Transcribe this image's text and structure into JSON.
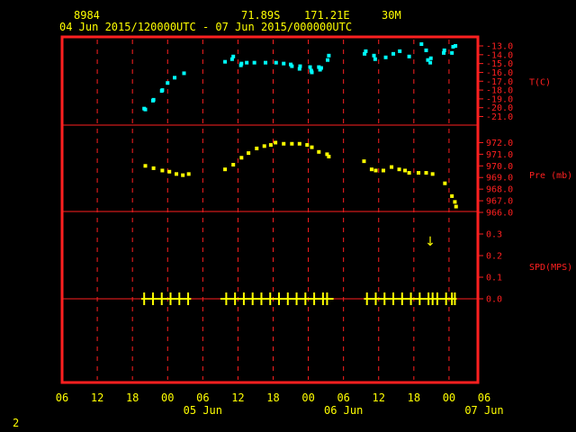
{
  "header": {
    "station_id": "8984",
    "lat": "71.89S",
    "lon": "171.21E",
    "interval": "30M",
    "period": "04 Jun 2015/120000UTC - 07 Jun 2015/000000UTC"
  },
  "footer": {
    "page_number": "2"
  },
  "colors": {
    "frame": "#ff2020",
    "temp": "#00ffff",
    "pressure": "#ffff00",
    "wind": "#ffff00",
    "text": "#ffff00"
  },
  "chart_data": [
    {
      "type": "scatter",
      "panel": "temperature",
      "ylabel": "T(C)",
      "ylim": [
        -21,
        -13
      ],
      "yticks": [
        "-13.0",
        "-14.0",
        "-15.0",
        "-16.0",
        "-17.0",
        "-18.0",
        "-19.0",
        "-20.0",
        "-21.0"
      ],
      "x_unit": "hours since 04 Jun 2015 06 UTC",
      "points": [
        [
          14,
          -20.1
        ],
        [
          14.2,
          -20.2
        ],
        [
          15.5,
          -19.2
        ],
        [
          15.6,
          -19.1
        ],
        [
          17,
          -18.1
        ],
        [
          17.1,
          -18.0
        ],
        [
          18,
          -17.2
        ],
        [
          19.2,
          -16.6
        ],
        [
          20.8,
          -16.1
        ],
        [
          27.8,
          -14.8
        ],
        [
          29,
          -14.5
        ],
        [
          29.2,
          -14.2
        ],
        [
          30.5,
          -15.2
        ],
        [
          30.6,
          -15.0
        ],
        [
          31.5,
          -14.9
        ],
        [
          32.8,
          -14.9
        ],
        [
          34.7,
          -14.9
        ],
        [
          36.5,
          -14.9
        ],
        [
          37.8,
          -15.0
        ],
        [
          39,
          -15.1
        ],
        [
          39.2,
          -15.3
        ],
        [
          40.5,
          -15.6
        ],
        [
          40.6,
          -15.3
        ],
        [
          42.3,
          -15.4
        ],
        [
          42.5,
          -15.8
        ],
        [
          42.6,
          -16.0
        ],
        [
          43.8,
          -15.4
        ],
        [
          44,
          -15.7
        ],
        [
          44.2,
          -15.5
        ],
        [
          45.3,
          -14.6
        ],
        [
          45.5,
          -14.1
        ],
        [
          51.6,
          -13.9
        ],
        [
          51.8,
          -13.6
        ],
        [
          53.2,
          -14.1
        ],
        [
          53.4,
          -14.5
        ],
        [
          55.2,
          -14.3
        ],
        [
          56.5,
          -13.9
        ],
        [
          57.6,
          -13.6
        ],
        [
          59.2,
          -14.2
        ],
        [
          61.3,
          -12.8
        ],
        [
          62.1,
          -13.5
        ],
        [
          62.4,
          -14.6
        ],
        [
          62.8,
          -14.9
        ],
        [
          62.9,
          -14.4
        ],
        [
          65.1,
          -13.8
        ],
        [
          65.2,
          -13.5
        ],
        [
          66.5,
          -13.8
        ],
        [
          66.7,
          -13.1
        ],
        [
          67.1,
          -13.0
        ]
      ]
    },
    {
      "type": "scatter",
      "panel": "pressure",
      "ylabel": "Pre (mb)",
      "ylim": [
        966,
        972.5
      ],
      "yticks": [
        "972.0",
        "971.0",
        "970.0",
        "969.0",
        "968.0",
        "967.0",
        "966.0"
      ],
      "x_unit": "hours since 04 Jun 2015 06 UTC",
      "points": [
        [
          14.2,
          970.0
        ],
        [
          15.6,
          969.8
        ],
        [
          17.1,
          969.6
        ],
        [
          18.3,
          969.5
        ],
        [
          19.5,
          969.3
        ],
        [
          20.6,
          969.2
        ],
        [
          21.6,
          969.3
        ],
        [
          27.8,
          969.7
        ],
        [
          29.2,
          970.1
        ],
        [
          30.6,
          970.7
        ],
        [
          31.8,
          971.1
        ],
        [
          33.2,
          971.5
        ],
        [
          34.5,
          971.7
        ],
        [
          35.6,
          971.8
        ],
        [
          36.4,
          972.0
        ],
        [
          37.8,
          971.9
        ],
        [
          39.2,
          971.9
        ],
        [
          40.5,
          971.9
        ],
        [
          41.8,
          971.8
        ],
        [
          42.6,
          971.6
        ],
        [
          43.8,
          971.2
        ],
        [
          45.2,
          971.0
        ],
        [
          45.5,
          970.8
        ],
        [
          51.5,
          970.4
        ],
        [
          52.8,
          969.7
        ],
        [
          53.5,
          969.6
        ],
        [
          54.8,
          969.6
        ],
        [
          56.2,
          969.9
        ],
        [
          57.5,
          969.7
        ],
        [
          58.5,
          969.6
        ],
        [
          59.2,
          969.4
        ],
        [
          60.8,
          969.4
        ],
        [
          62.1,
          969.4
        ],
        [
          63.2,
          969.3
        ],
        [
          65.3,
          968.5
        ],
        [
          66.5,
          967.4
        ],
        [
          67.0,
          966.9
        ],
        [
          67.2,
          966.5
        ]
      ]
    },
    {
      "type": "line",
      "panel": "wind_speed",
      "ylabel": "SPD(MPS)",
      "ylim": [
        0,
        0.3
      ],
      "yticks": [
        "0.3",
        "0.2",
        "0.1",
        "0.0"
      ],
      "x_unit": "hours since 04 Jun 2015 06 UTC",
      "series": [
        {
          "x_segments": [
            [
              13.5,
              22.0
            ],
            [
              27.0,
              46.3
            ],
            [
              51.5,
              67.3
            ]
          ],
          "values": [
            0,
            0,
            0
          ],
          "direction_markers_hours": [
            14,
            15.5,
            17,
            18.5,
            20,
            21.5,
            28,
            29.5,
            31,
            32.5,
            34,
            35.5,
            37,
            38.5,
            40,
            41.5,
            43,
            44.5,
            45.2,
            52,
            53.5,
            55,
            56.5,
            58,
            59.5,
            61,
            62.5,
            63.2,
            64,
            65.5,
            66.5,
            67
          ]
        }
      ],
      "annotations": [
        {
          "text": "↓",
          "x_hours": 62.5,
          "value": 0.27
        }
      ]
    }
  ],
  "x_axis": {
    "tick_labels": [
      "06",
      "12",
      "18",
      "00",
      "06",
      "12",
      "18",
      "00",
      "06",
      "12",
      "18",
      "00",
      "06"
    ],
    "day_labels": [
      {
        "text": "05 Jun",
        "x_hours": 24
      },
      {
        "text": "06 Jun",
        "x_hours": 48
      },
      {
        "text": "07 Jun",
        "x_hours": 72
      }
    ],
    "range_hours": [
      0,
      72
    ]
  }
}
